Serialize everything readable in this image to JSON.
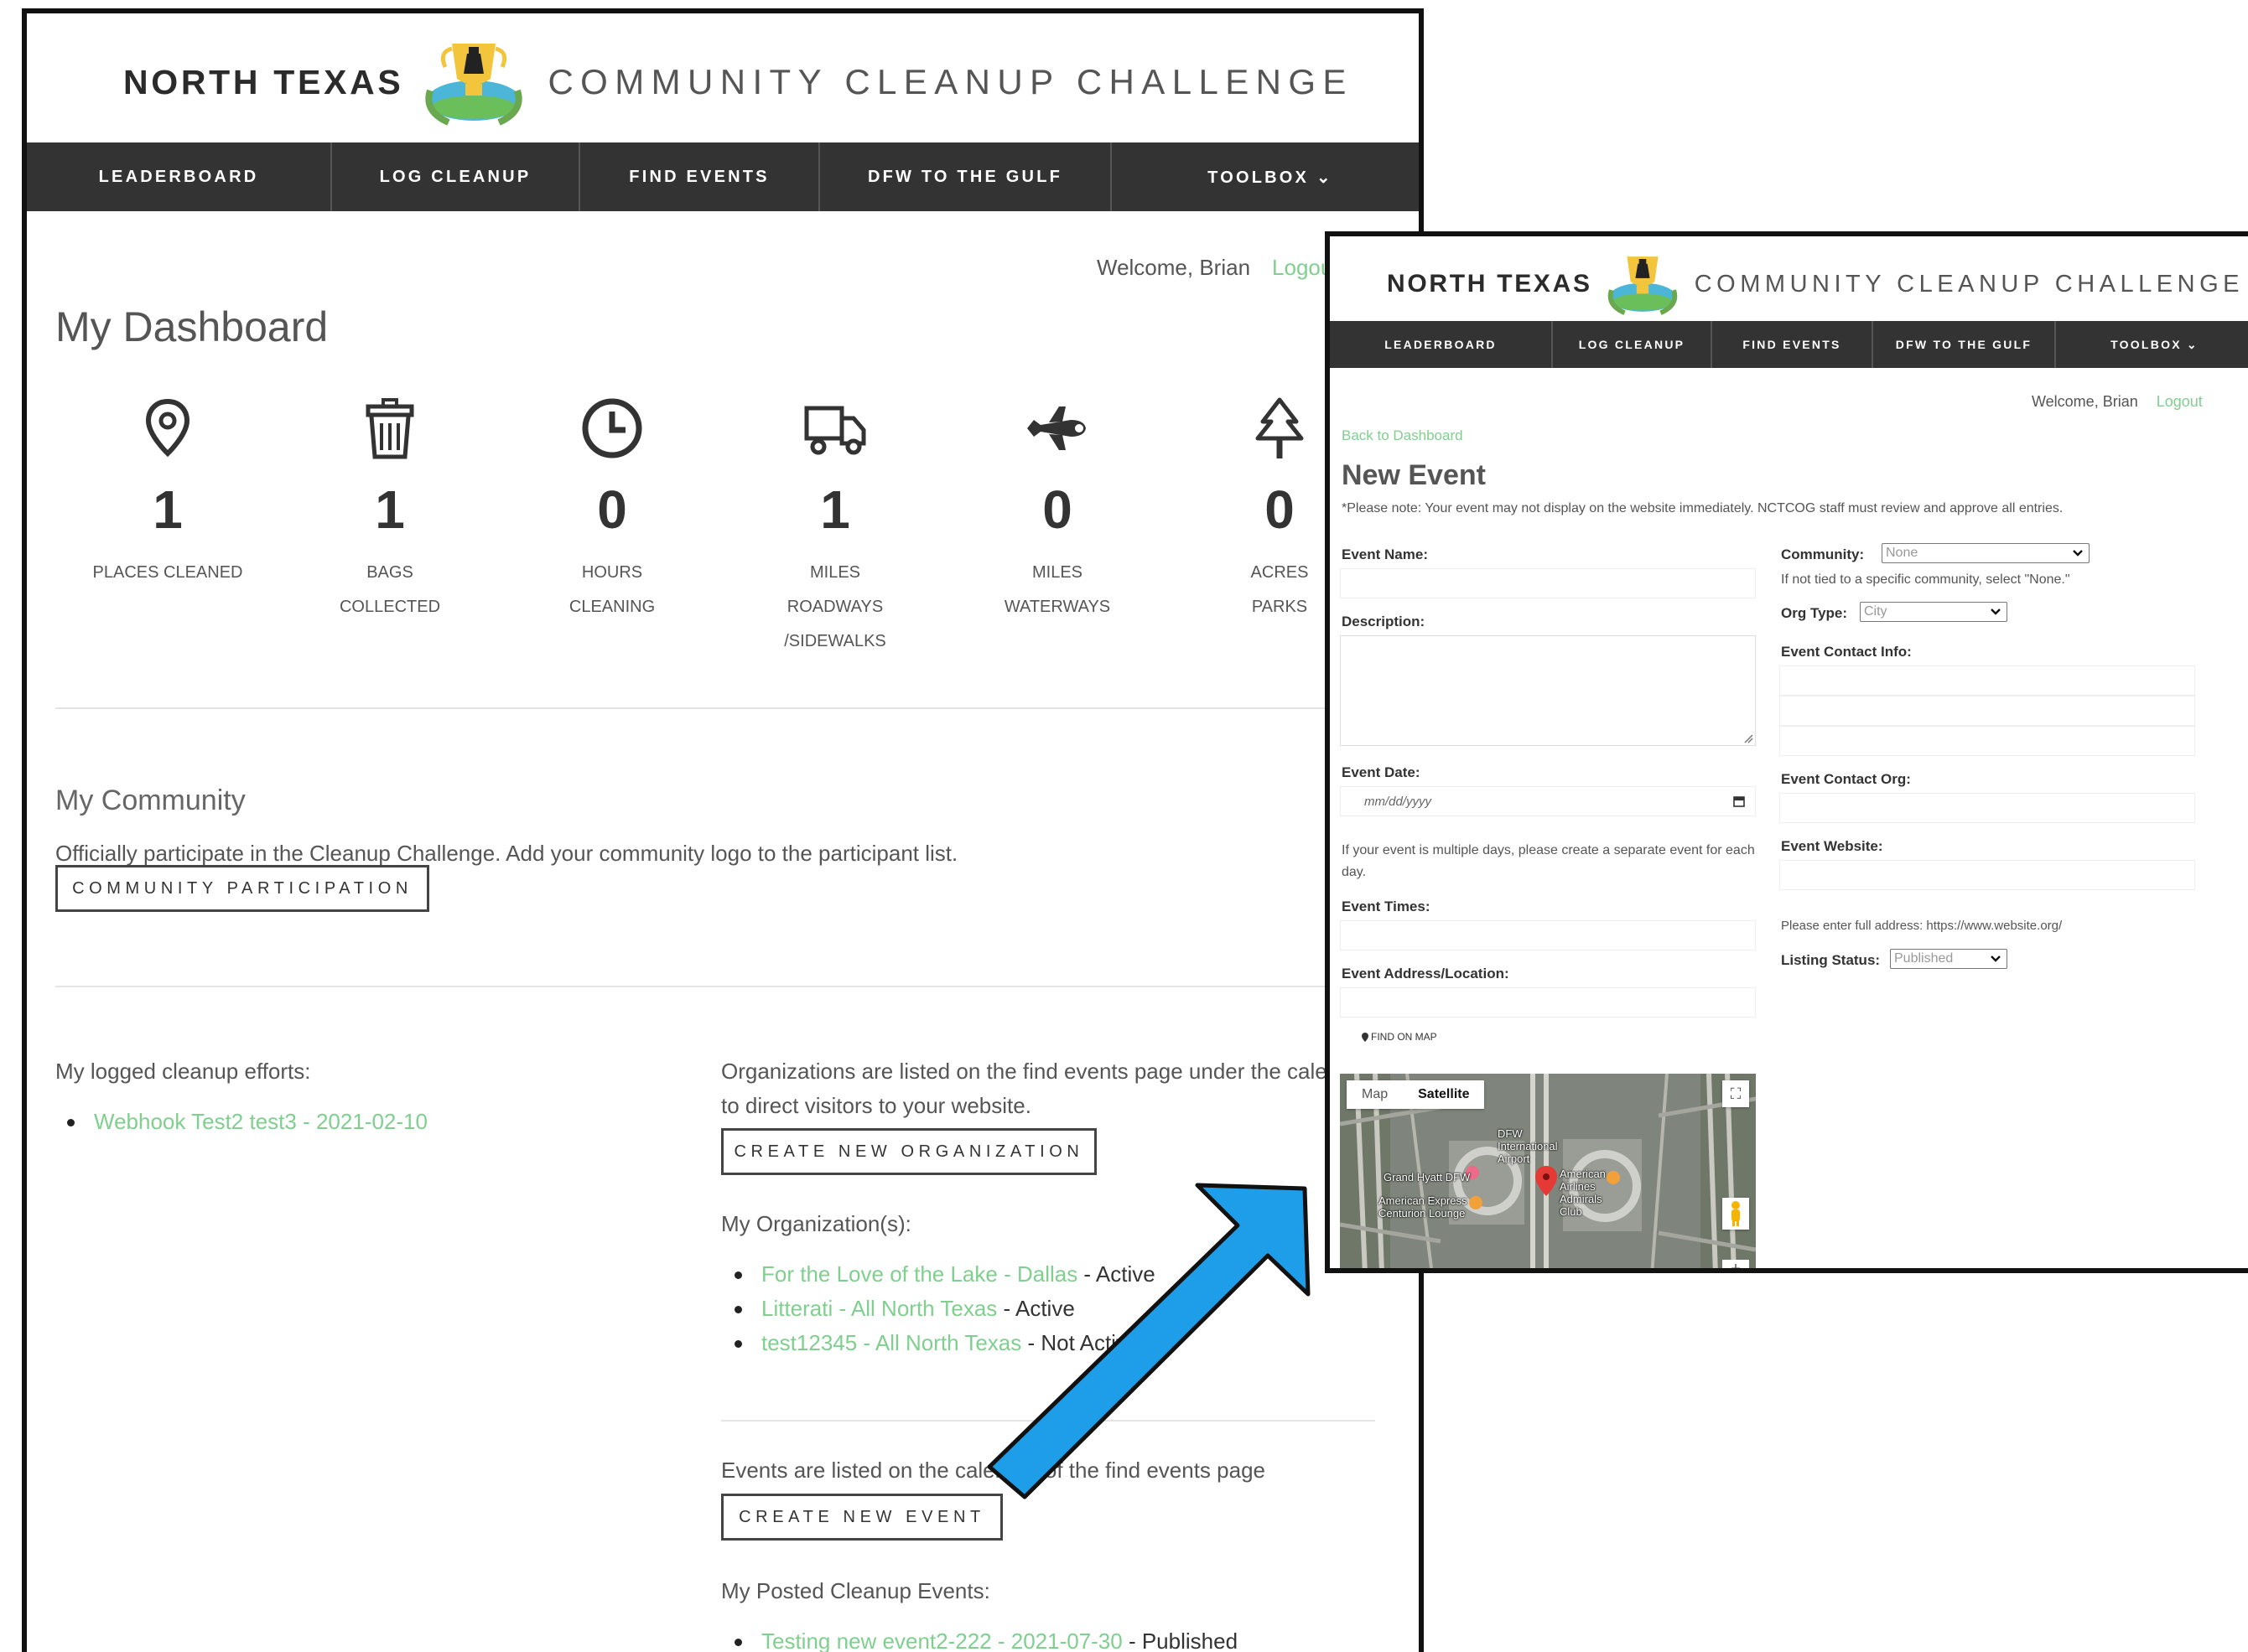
{
  "dashboard": {
    "brand": {
      "left": "NORTH TEXAS",
      "right": "COMMUNITY CLEANUP CHALLENGE"
    },
    "nav": [
      "LEADERBOARD",
      "LOG CLEANUP",
      "FIND EVENTS",
      "DFW TO THE GULF",
      "TOOLBOX ⌄"
    ],
    "welcome": "Welcome, Brian",
    "logout": "Logout",
    "title": "My Dashboard",
    "stats": [
      {
        "icon": "map-pin-icon",
        "value": "1",
        "label_lines": [
          "PLACES CLEANED"
        ]
      },
      {
        "icon": "trash-can-icon",
        "value": "1",
        "label_lines": [
          "BAGS",
          "COLLECTED"
        ]
      },
      {
        "icon": "clock-icon",
        "value": "0",
        "label_lines": [
          "HOURS",
          "CLEANING"
        ]
      },
      {
        "icon": "truck-icon",
        "value": "1",
        "label_lines": [
          "MILES",
          "ROADWAYS",
          "/SIDEWALKS"
        ]
      },
      {
        "icon": "airplane-icon",
        "value": "0",
        "label_lines": [
          "MILES",
          "WATERWAYS"
        ]
      },
      {
        "icon": "tree-icon",
        "value": "0",
        "label_lines": [
          "ACRES",
          "PARKS"
        ]
      }
    ],
    "community": {
      "heading": "My Community",
      "text": "Officially participate in the Cleanup Challenge. Add your community logo to the participant list.",
      "button": "COMMUNITY PARTICIPATION"
    },
    "logged": {
      "heading": "My logged cleanup efforts:",
      "items": [
        {
          "link": "Webhook Test2 test3 - 2021-02-10"
        }
      ]
    },
    "organizations": {
      "text": "Organizations are listed on the find events page under the calendar to direct visitors to your website.",
      "button": "CREATE NEW ORGANIZATION",
      "heading": "My Organization(s):",
      "items": [
        {
          "link": "For the Love of the Lake - Dallas",
          "status": " - Active"
        },
        {
          "link": "Litterati - All North Texas",
          "status": " - Active"
        },
        {
          "link": "test12345 - All North Texas",
          "status": " - Not Active"
        }
      ]
    },
    "events": {
      "text": "Events are listed on the calendar of the find events page",
      "button": "CREATE NEW EVENT",
      "heading": "My Posted Cleanup Events:",
      "items": [
        {
          "link": "Testing new event2-222 - 2021-07-30",
          "status": " - Published"
        }
      ]
    }
  },
  "new_event": {
    "brand": {
      "left": "NORTH TEXAS",
      "right": "COMMUNITY CLEANUP CHALLENGE"
    },
    "nav": [
      "LEADERBOARD",
      "LOG CLEANUP",
      "FIND EVENTS",
      "DFW TO THE GULF",
      "TOOLBOX ⌄"
    ],
    "welcome": "Welcome, Brian",
    "logout": "Logout",
    "back": "Back to Dashboard",
    "title": "New Event",
    "note": "*Please note: Your event may not display on the website immediately. NCTCOG staff must review and approve all entries.",
    "fields": {
      "event_name": "Event Name:",
      "description": "Description:",
      "event_date": "Event Date:",
      "date_placeholder": "mm/dd/yyyy",
      "multi_day_help": "If your event is multiple days, please create a separate event for each day.",
      "event_times": "Event Times:",
      "address": "Event Address/Location:",
      "find_on_map": "FIND ON MAP",
      "community": "Community:",
      "community_value": "None",
      "community_help": "If not tied to a specific community, select \"None.\"",
      "org_type": "Org Type:",
      "org_type_value": "City",
      "contact_info": "Event Contact Info:",
      "contact_org": "Event Contact Org:",
      "website": "Event Website:",
      "website_help": "Please enter full address: https://www.website.org/",
      "listing_status": "Listing Status:",
      "listing_status_value": "Published"
    },
    "map": {
      "tabs": [
        "Map",
        "Satellite"
      ],
      "labels": [
        "DFW International Airport",
        "Grand Hyatt DFW",
        "American Express Centurion Lounge",
        "American Airlines Admirals Club"
      ]
    }
  },
  "colors": {
    "nav_bg": "#333333",
    "link": "#7fcf8e",
    "arrow": "#1e9de8"
  }
}
